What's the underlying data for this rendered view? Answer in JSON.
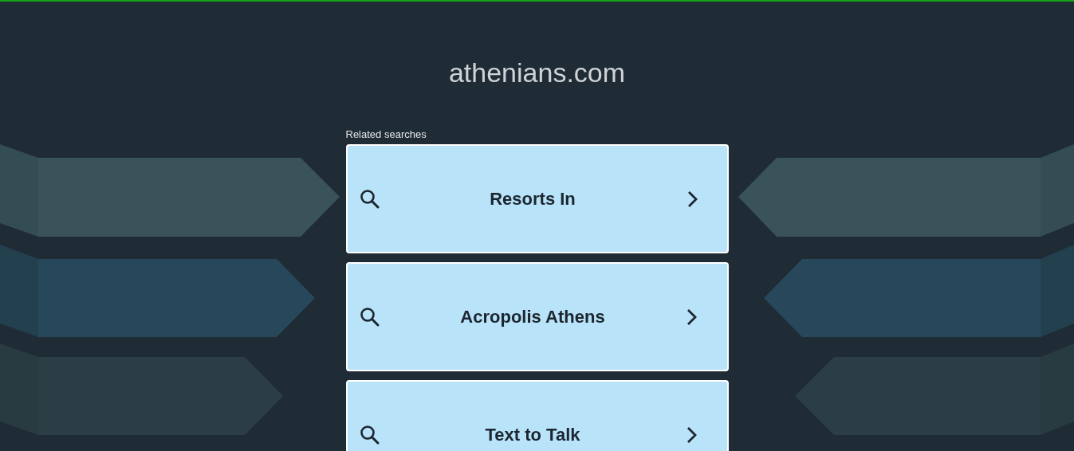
{
  "site_title": "athenians.com",
  "related_label": "Related searches",
  "searches": [
    {
      "label": "Resorts In"
    },
    {
      "label": "Acropolis Athens"
    },
    {
      "label": "Text to Talk"
    }
  ]
}
